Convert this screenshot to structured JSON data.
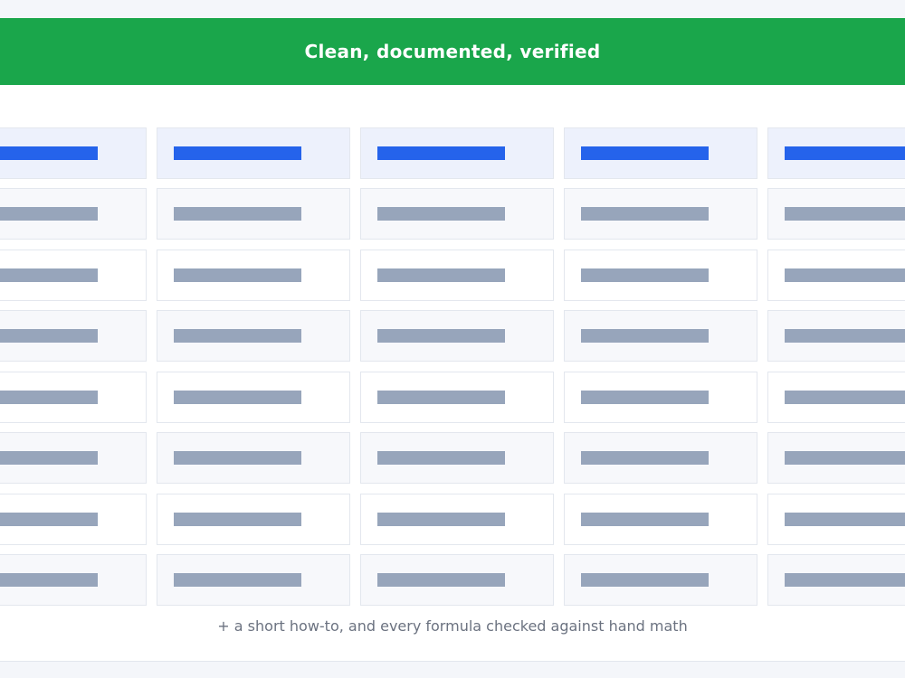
{
  "banner": {
    "title": "Clean, documented, verified",
    "color": "#1aa64b"
  },
  "table": {
    "columns": 5,
    "rows": 8,
    "header_rows": 1,
    "header_bar_color": "#2563eb",
    "body_bar_color": "#97a5bb"
  },
  "footnote": {
    "text": "+ a short how-to, and every formula checked against hand math"
  }
}
